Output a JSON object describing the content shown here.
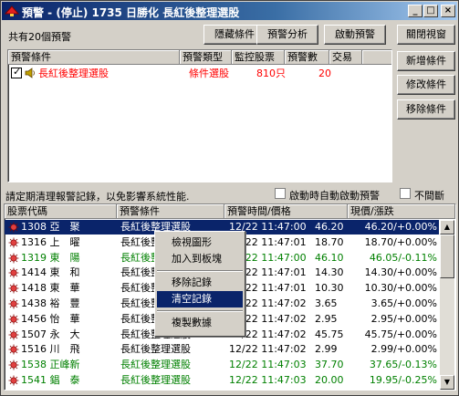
{
  "window": {
    "title": "預警 - (停止) 1735 日勝化 長紅後整理選股",
    "controls": {
      "minimize": "_",
      "maximize": "□",
      "close": "×"
    }
  },
  "top": {
    "count_label": "共有20個預警",
    "buttons": {
      "hide": "隱藏條件",
      "analyze": "預警分析",
      "start": "啟動預警"
    }
  },
  "side_buttons": {
    "close": "關閉視窗",
    "add": "新增條件",
    "modify": "修改條件",
    "remove": "移除條件"
  },
  "conditions": {
    "headers": [
      "預警條件",
      "預警類型",
      "監控股票",
      "預警數",
      "交易"
    ],
    "rows": [
      {
        "checked": true,
        "name": "長紅後整理選股",
        "type": "條件選股",
        "stocks": "810只",
        "count": "20",
        "trade": ""
      }
    ]
  },
  "notice": {
    "text": "請定期清理報警記錄，以免影響系統性能.",
    "auto_start_label": "啟動時自動啟動預警",
    "no_interrupt_label": "不間斷"
  },
  "records": {
    "headers": [
      "股票代碼",
      "預警條件",
      "預警時間/價格",
      "現價/漲跌"
    ],
    "rows": [
      {
        "code": "1308 亞　聚",
        "cond": "長紅後整理選股",
        "time": "12/22 11:47:00",
        "price": "46.20",
        "now": "46.20/+0.00%",
        "color": "#000000",
        "selected": true
      },
      {
        "code": "1316 上　曜",
        "cond": "長紅後整理選股",
        "time": "12/22 11:47:01",
        "price": "18.70",
        "now": "18.70/+0.00%",
        "color": "#000000"
      },
      {
        "code": "1319 東　陽",
        "cond": "長紅後整理選股",
        "time": "12/22 11:47:00",
        "price": "46.10",
        "now": "46.05/-0.11%",
        "color": "#008000"
      },
      {
        "code": "1414 東　和",
        "cond": "長紅後整理選股",
        "time": "12/22 11:47:01",
        "price": "14.30",
        "now": "14.30/+0.00%",
        "color": "#000000"
      },
      {
        "code": "1418 東　華",
        "cond": "長紅後整理選股",
        "time": "12/22 11:47:01",
        "price": "10.30",
        "now": "10.30/+0.00%",
        "color": "#000000"
      },
      {
        "code": "1438 裕　豐",
        "cond": "長紅後整理選股",
        "time": "12/22 11:47:02",
        "price": "3.65",
        "now": "3.65/+0.00%",
        "color": "#000000"
      },
      {
        "code": "1456 怡　華",
        "cond": "長紅後整理選股",
        "time": "12/22 11:47:02",
        "price": "2.95",
        "now": "2.95/+0.00%",
        "color": "#000000"
      },
      {
        "code": "1507 永　大",
        "cond": "長紅後整理選股",
        "time": "12/22 11:47:02",
        "price": "45.75",
        "now": "45.75/+0.00%",
        "color": "#000000"
      },
      {
        "code": "1516 川　飛",
        "cond": "長紅後整理選股",
        "time": "12/22 11:47:02",
        "price": "2.99",
        "now": "2.99/+0.00%",
        "color": "#000000"
      },
      {
        "code": "1538 正峰新",
        "cond": "長紅後整理選股",
        "time": "12/22 11:47:03",
        "price": "37.70",
        "now": "37.65/-0.13%",
        "color": "#008000"
      },
      {
        "code": "1541 錩　泰",
        "cond": "長紅後整理選股",
        "time": "12/22 11:47:03",
        "price": "20.00",
        "now": "19.95/-0.25%",
        "color": "#008000"
      }
    ]
  },
  "context_menu": {
    "items": [
      {
        "label": "檢視圖形",
        "highlighted": false
      },
      {
        "label": "加入到板塊",
        "highlighted": false
      },
      {
        "label": "移除記錄",
        "highlighted": false
      },
      {
        "label": "清空記錄",
        "highlighted": true
      },
      {
        "label": "複製數據",
        "highlighted": false
      }
    ]
  },
  "colors": {
    "title_bar": "#0a246a",
    "condition_red": "#ff0000",
    "rise_green": "#008000",
    "selection": "#0a246a"
  }
}
